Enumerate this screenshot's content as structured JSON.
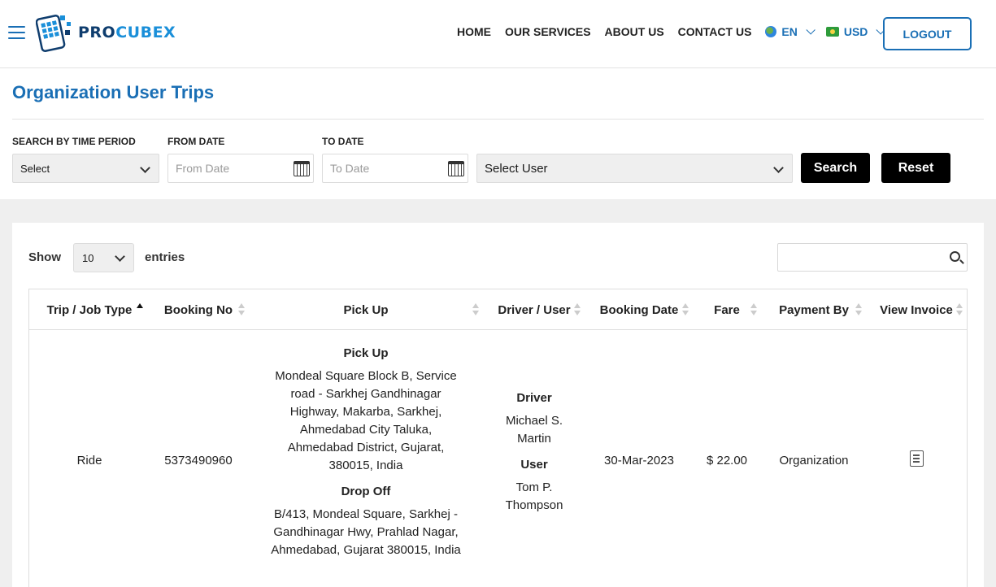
{
  "header": {
    "logo_pro": "PRO",
    "logo_cubex": "CUBEX",
    "nav": [
      "HOME",
      "OUR SERVICES",
      "ABOUT US",
      "CONTACT US"
    ],
    "language": "EN",
    "currency": "USD",
    "logout": "LOGOUT"
  },
  "page": {
    "title": "Organization User Trips"
  },
  "filters": {
    "time_period_label": "SEARCH BY TIME PERIOD",
    "time_period_value": "Select",
    "from_label": "FROM DATE",
    "from_placeholder": "From Date",
    "to_label": "TO DATE",
    "to_placeholder": "To Date",
    "user_value": "Select User",
    "search_btn": "Search",
    "reset_btn": "Reset"
  },
  "table_controls": {
    "show": "Show",
    "entries_value": "10",
    "entries": "entries"
  },
  "table": {
    "headers": [
      "Trip / Job Type",
      "Booking No",
      "Pick Up",
      "Driver / User",
      "Booking Date",
      "Fare",
      "Payment By",
      "View Invoice"
    ],
    "rows": [
      {
        "type": "Ride",
        "booking_no": "5373490960",
        "pickup_heading": "Pick Up",
        "pickup_lines": [
          "Mondeal Square Block B, Service",
          "road - Sarkhej Gandhinagar",
          "Highway, Makarba, Sarkhej,",
          "Ahmedabad City Taluka,",
          "Ahmedabad District, Gujarat,",
          "380015, India"
        ],
        "dropoff_heading": "Drop Off",
        "dropoff_lines": [
          "B/413, Mondeal Square, Sarkhej -",
          "Gandhinagar Hwy, Prahlad Nagar,",
          "Ahmedabad, Gujarat 380015, India"
        ],
        "driver_heading": "Driver",
        "driver_lines": [
          "Michael S.",
          "Martin"
        ],
        "user_heading": "User",
        "user_lines": [
          "Tom P.",
          "Thompson"
        ],
        "booking_date": "30-Mar-2023",
        "fare": "$ 22.00",
        "payment_by": "Organization"
      }
    ]
  },
  "icons": [
    "hamburger-icon",
    "procubex-logo-icon",
    "globe-flag-icon",
    "usd-flag-icon",
    "calendar-icon",
    "search-icon",
    "invoice-icon",
    "sort-icon"
  ],
  "colors": {
    "accent": "#1a6fb5",
    "logo_dark": "#0f3d6e",
    "logo_light": "#1a8fd9",
    "button_dark": "#000000"
  }
}
